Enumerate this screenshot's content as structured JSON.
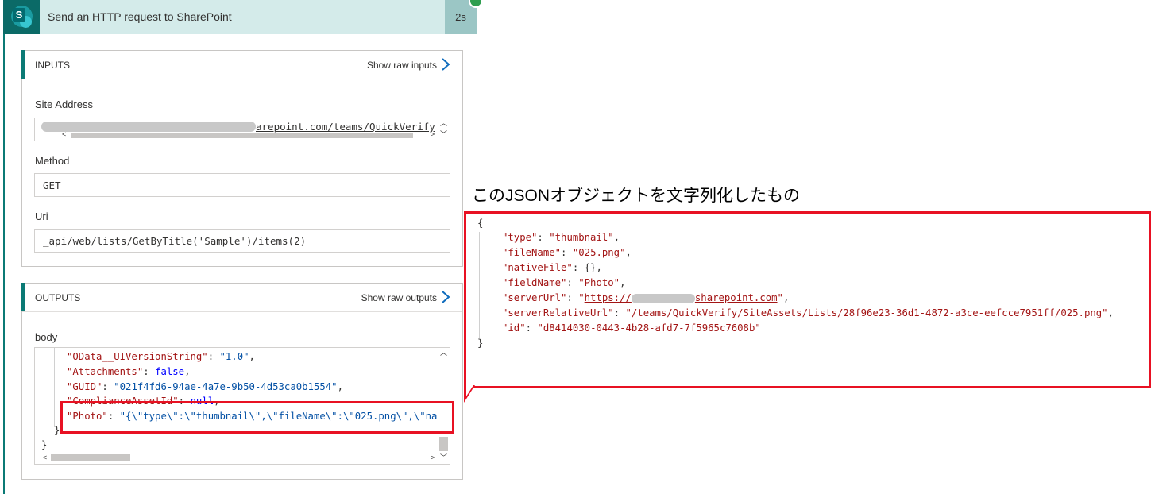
{
  "header": {
    "title": "Send an HTTP request to SharePoint",
    "duration": "2s"
  },
  "inputs": {
    "section_label": "INPUTS",
    "show_raw_label": "Show raw inputs",
    "site_address_label": "Site Address",
    "site_address_value": "arepoint.com/teams/QuickVerify",
    "method_label": "Method",
    "method_value": "GET",
    "uri_label": "Uri",
    "uri_value": "_api/web/lists/GetByTitle('Sample')/items(2)"
  },
  "outputs": {
    "section_label": "OUTPUTS",
    "show_raw_label": "Show raw outputs",
    "body_label": "body",
    "lines": [
      {
        "key": "\"OData__UIVersionString\"",
        "sep": ": ",
        "val": "\"1.0\"",
        "end": ","
      },
      {
        "key": "\"Attachments\"",
        "sep": ": ",
        "val": "false",
        "end": ","
      },
      {
        "key": "\"GUID\"",
        "sep": ": ",
        "val": "\"021f4fd6-94ae-4a7e-9b50-4d53ca0b1554\"",
        "end": ","
      },
      {
        "key": "\"ComplianceAssetId\"",
        "sep": ": ",
        "val": "null",
        "end": ","
      },
      {
        "key": "\"Photo\"",
        "sep": ": ",
        "val": "\"{\\\"type\\\":\\\"thumbnail\\\",\\\"fileName\\\":\\\"025.png\\\",\\\"na",
        "end": ""
      }
    ],
    "close_inner": "}",
    "close_outer": "}"
  },
  "callout": {
    "title": "このJSONオブジェクトを文字列化したもの",
    "open": "{",
    "close": "}",
    "lines": [
      {
        "key": "\"type\"",
        "val": "\"thumbnail\"",
        "end": ","
      },
      {
        "key": "\"fileName\"",
        "val": "\"025.png\"",
        "end": ","
      },
      {
        "key": "\"nativeFile\"",
        "val": "{}",
        "end": ","
      },
      {
        "key": "\"fieldName\"",
        "val": "\"Photo\"",
        "end": ","
      },
      {
        "key": "\"serverUrl\"",
        "val_prefix": "\"",
        "val_link1": "https://",
        "val_link2": "sharepoint.com",
        "val_suffix": "\"",
        "end": ","
      },
      {
        "key": "\"serverRelativeUrl\"",
        "val": "\"/teams/QuickVerify/SiteAssets/Lists/28f96e23-36d1-4872-a3ce-eefcce7951ff/025.png\"",
        "end": ","
      },
      {
        "key": "\"id\"",
        "val": "\"d8414030-0443-4b28-afd7-7f5965c7608b\"",
        "end": ""
      }
    ]
  },
  "colors": {
    "accent": "#0b7a75",
    "highlight": "#e81123",
    "link": "#0f6cbd"
  }
}
